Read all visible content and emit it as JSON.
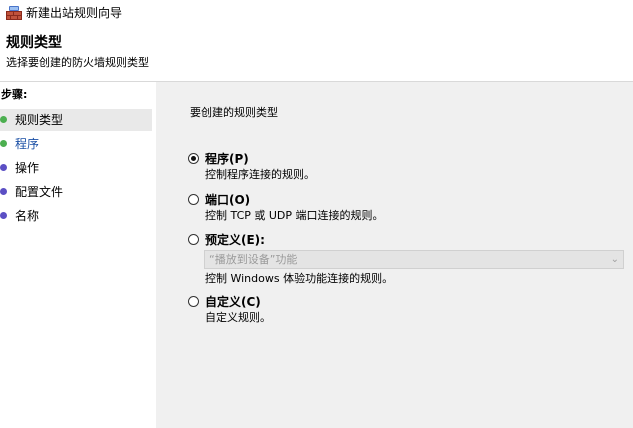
{
  "window": {
    "title": "新建出站规则向导",
    "icon": "firewall-icon"
  },
  "header": {
    "title": "规则类型",
    "subtitle": "选择要创建的防火墙规则类型"
  },
  "steps": {
    "title": "步骤:",
    "items": [
      {
        "label": "规则类型",
        "active": true,
        "bullet_color": "#4caf50"
      },
      {
        "label": "程序",
        "active": false,
        "bullet_color": "#4caf50"
      },
      {
        "label": "操作",
        "active": false,
        "bullet_color": "#5b4fc4"
      },
      {
        "label": "配置文件",
        "active": false,
        "bullet_color": "#5b4fc4"
      },
      {
        "label": "名称",
        "active": false,
        "bullet_color": "#5b4fc4"
      }
    ]
  },
  "content": {
    "question": "要创建的规则类型",
    "options": [
      {
        "label": "程序(P)",
        "description": "控制程序连接的规则。",
        "checked": true
      },
      {
        "label": "端口(O)",
        "description": "控制 TCP 或 UDP 端口连接的规则。",
        "checked": false
      },
      {
        "label": "预定义(E):",
        "description": "",
        "checked": false
      },
      {
        "label": "自定义(C)",
        "description": "自定义规则。",
        "checked": false
      }
    ],
    "predefined_combo": {
      "selected": "“播放到设备”功能",
      "description": "控制 Windows 体验功能连接的规则。",
      "disabled": true
    }
  },
  "colors": {
    "link": "#1a4fa5",
    "panel_bg": "#f0f0f0",
    "active_step_bg": "#e9e9e9"
  }
}
